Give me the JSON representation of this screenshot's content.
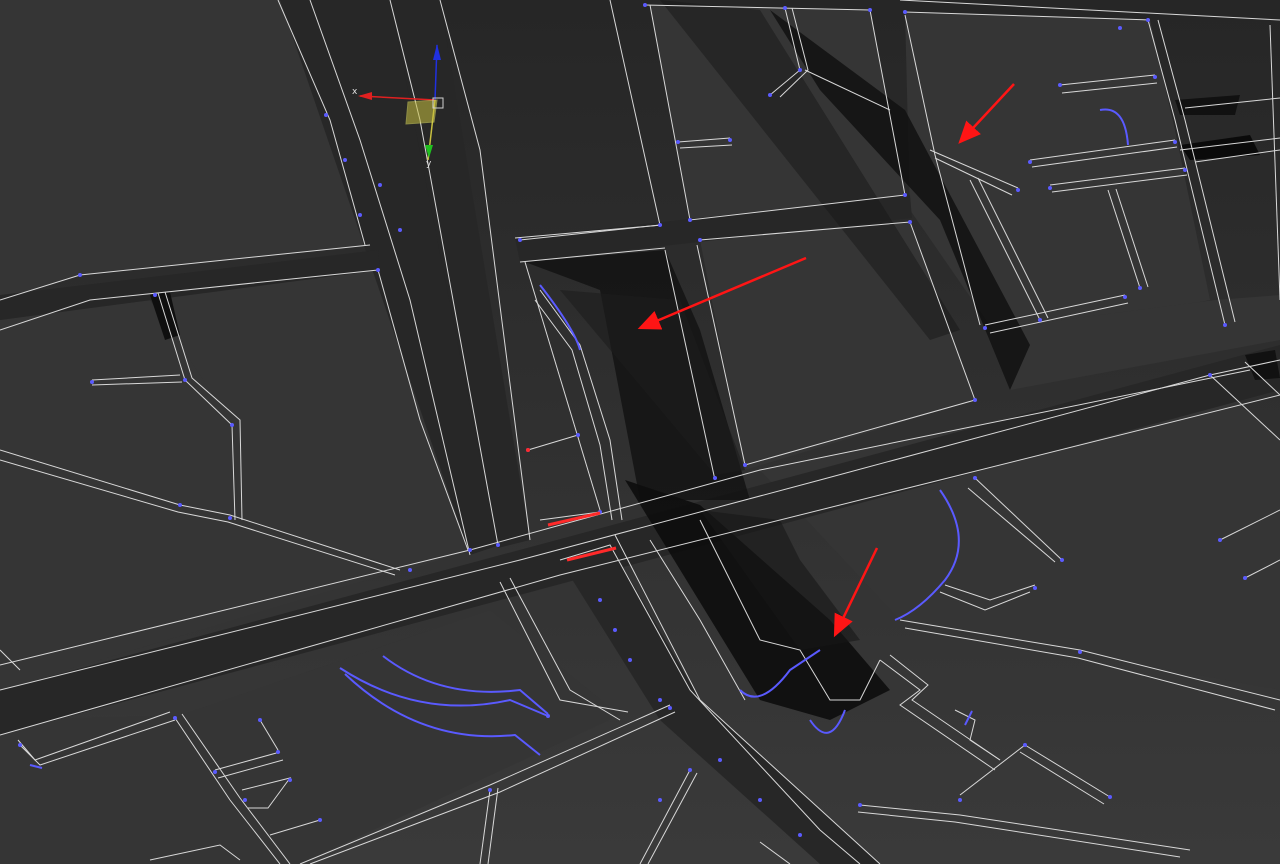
{
  "viewport": {
    "background_top": "#262626",
    "background_bottom": "#3a3a3a",
    "edge_color": "#d8d8d8",
    "vertex_color": "#5b5bff",
    "selection_color": "#ff2a2a",
    "annotation_color": "#ff1515"
  },
  "gizmo": {
    "x_label": "x",
    "y_label": "y",
    "z_label": "z",
    "x_color": "#e02020",
    "y_color": "#20c020",
    "z_color": "#2030e0",
    "plane_color": "#c8c040"
  },
  "annotations": {
    "arrow_count": 3,
    "meaning": ""
  }
}
